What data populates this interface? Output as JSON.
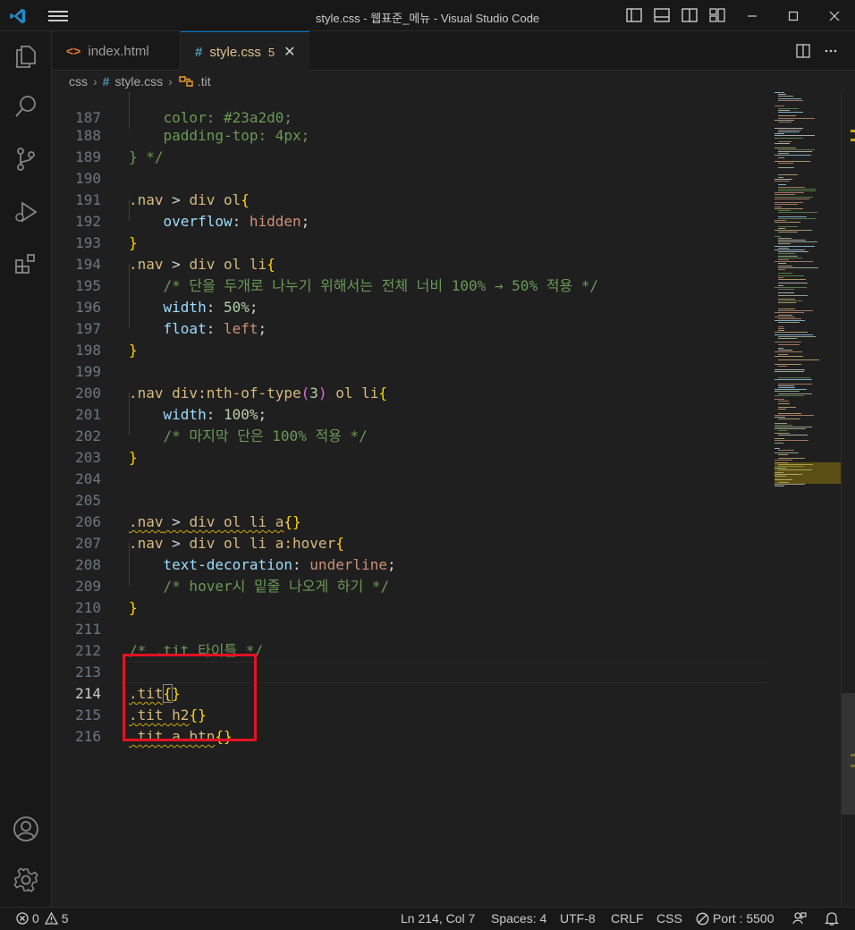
{
  "window": {
    "title": "style.css - 웹표준_메뉴 - Visual Studio Code"
  },
  "tabs": [
    {
      "label": "index.html",
      "icon": "html-file-icon",
      "active": false
    },
    {
      "label": "style.css",
      "icon": "css-file-icon",
      "active": true,
      "badge": "5"
    }
  ],
  "breadcrumb": {
    "folder": "css",
    "file": "style.css",
    "symbol": ".tit"
  },
  "editor": {
    "current_line": 214,
    "lines": [
      {
        "n": "187",
        "text": "    color: #23a2d0;"
      },
      {
        "n": "188",
        "text": "    padding-top: 4px;"
      },
      {
        "n": "189",
        "text": "} */"
      },
      {
        "n": "190",
        "text": ""
      },
      {
        "n": "191",
        "text": ".nav > div ol{"
      },
      {
        "n": "192",
        "text": "    overflow: hidden;"
      },
      {
        "n": "193",
        "text": "}"
      },
      {
        "n": "194",
        "text": ".nav > div ol li{"
      },
      {
        "n": "195",
        "text": "    /* 단을 두개로 나누기 위해서는 전체 너비 100% → 50% 적용 */"
      },
      {
        "n": "196",
        "text": "    width: 50%;"
      },
      {
        "n": "197",
        "text": "    float: left;"
      },
      {
        "n": "198",
        "text": "}"
      },
      {
        "n": "199",
        "text": ""
      },
      {
        "n": "200",
        "text": ".nav div:nth-of-type(3) ol li{"
      },
      {
        "n": "201",
        "text": "    width: 100%;"
      },
      {
        "n": "202",
        "text": "    /* 마지막 단은 100% 적용 */"
      },
      {
        "n": "203",
        "text": "}"
      },
      {
        "n": "204",
        "text": ""
      },
      {
        "n": "205",
        "text": ""
      },
      {
        "n": "206",
        "text": ".nav > div ol li a{}"
      },
      {
        "n": "207",
        "text": ".nav > div ol li a:hover{"
      },
      {
        "n": "208",
        "text": "    text-decoration: underline;"
      },
      {
        "n": "209",
        "text": "    /* hover시 밑줄 나오게 하기 */"
      },
      {
        "n": "210",
        "text": "}"
      },
      {
        "n": "211",
        "text": ""
      },
      {
        "n": "212",
        "text": "/* .tit 타이틀 */"
      },
      {
        "n": "213",
        "text": ""
      },
      {
        "n": "214",
        "text": ".tit{}"
      },
      {
        "n": "215",
        "text": ".tit h2{}"
      },
      {
        "n": "216",
        "text": ".tit a.btn{}"
      }
    ]
  },
  "statusbar": {
    "errors": "0",
    "warnings": "5",
    "position": "Ln 214, Col 7",
    "spaces": "Spaces: 4",
    "encoding": "UTF-8",
    "eol": "CRLF",
    "language": "CSS",
    "port": "Port : 5500"
  },
  "colors": {
    "accent": "#0078d4",
    "modified": "#e2c08d",
    "highlight_box": "#e81123",
    "warning": "#cca700"
  }
}
